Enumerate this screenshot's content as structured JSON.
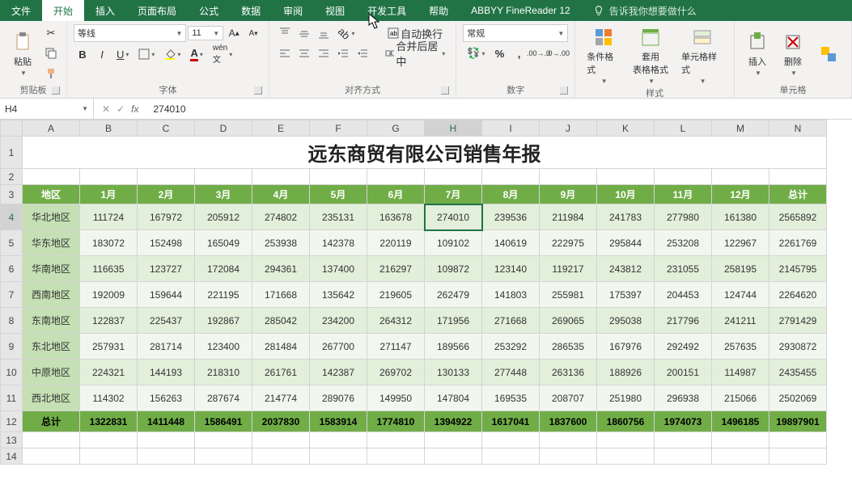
{
  "tabs": {
    "file": "文件",
    "home": "开始",
    "insert": "插入",
    "layout": "页面布局",
    "formula": "公式",
    "data": "数据",
    "review": "审阅",
    "view": "视图",
    "dev": "开发工具",
    "help": "帮助",
    "addon": "ABBYY FineReader 12",
    "tell": "告诉我你想要做什么"
  },
  "groups": {
    "clipboard": {
      "label": "剪贴板",
      "paste": "粘贴"
    },
    "font": {
      "label": "字体",
      "name": "等线",
      "size": "11"
    },
    "align": {
      "label": "对齐方式",
      "wrap": "自动换行",
      "merge": "合并后居中"
    },
    "number": {
      "label": "数字",
      "format": "常规"
    },
    "styles": {
      "label": "样式",
      "cond": "条件格式",
      "table": "套用\n表格格式",
      "cell": "单元格样式"
    },
    "cells": {
      "label": "单元格",
      "insert": "插入",
      "delete": "删除"
    }
  },
  "namebox": "H4",
  "formula": "274010",
  "cols": [
    "A",
    "B",
    "C",
    "D",
    "E",
    "F",
    "G",
    "H",
    "I",
    "J",
    "K",
    "L",
    "M",
    "N"
  ],
  "title": "远东商贸有限公司销售年报",
  "headers": [
    "地区",
    "1月",
    "2月",
    "3月",
    "4月",
    "5月",
    "6月",
    "7月",
    "8月",
    "9月",
    "10月",
    "11月",
    "12月",
    "总计"
  ],
  "chart_data": {
    "type": "table",
    "title": "远东商贸有限公司销售年报",
    "columns": [
      "地区",
      "1月",
      "2月",
      "3月",
      "4月",
      "5月",
      "6月",
      "7月",
      "8月",
      "9月",
      "10月",
      "11月",
      "12月",
      "总计"
    ],
    "rows": [
      [
        "华北地区",
        111724,
        167972,
        205912,
        274802,
        235131,
        163678,
        274010,
        239536,
        211984,
        241783,
        277980,
        161380,
        2565892
      ],
      [
        "华东地区",
        183072,
        152498,
        165049,
        253938,
        142378,
        220119,
        109102,
        140619,
        222975,
        295844,
        253208,
        122967,
        2261769
      ],
      [
        "华南地区",
        116635,
        123727,
        172084,
        294361,
        137400,
        216297,
        109872,
        123140,
        119217,
        243812,
        231055,
        258195,
        2145795
      ],
      [
        "西南地区",
        192009,
        159644,
        221195,
        171668,
        135642,
        219605,
        262479,
        141803,
        255981,
        175397,
        204453,
        124744,
        2264620
      ],
      [
        "东南地区",
        122837,
        225437,
        192867,
        285042,
        234200,
        264312,
        171956,
        271668,
        269065,
        295038,
        217796,
        241211,
        2791429
      ],
      [
        "东北地区",
        257931,
        281714,
        123400,
        281484,
        267700,
        271147,
        189566,
        253292,
        286535,
        167976,
        292492,
        257635,
        2930872
      ],
      [
        "中原地区",
        224321,
        144193,
        218310,
        261761,
        142387,
        269702,
        130133,
        277448,
        263136,
        188926,
        200151,
        114987,
        2435455
      ],
      [
        "西北地区",
        114302,
        156263,
        287674,
        214774,
        289076,
        149950,
        147804,
        169535,
        208707,
        251980,
        296938,
        215066,
        2502069
      ]
    ],
    "totals": [
      "总计",
      1322831,
      1411448,
      1586491,
      2037830,
      1583914,
      1774810,
      1394922,
      1617041,
      1837600,
      1860756,
      1974073,
      1496185,
      19897901
    ]
  },
  "selected": {
    "col": "H",
    "row": 4
  }
}
